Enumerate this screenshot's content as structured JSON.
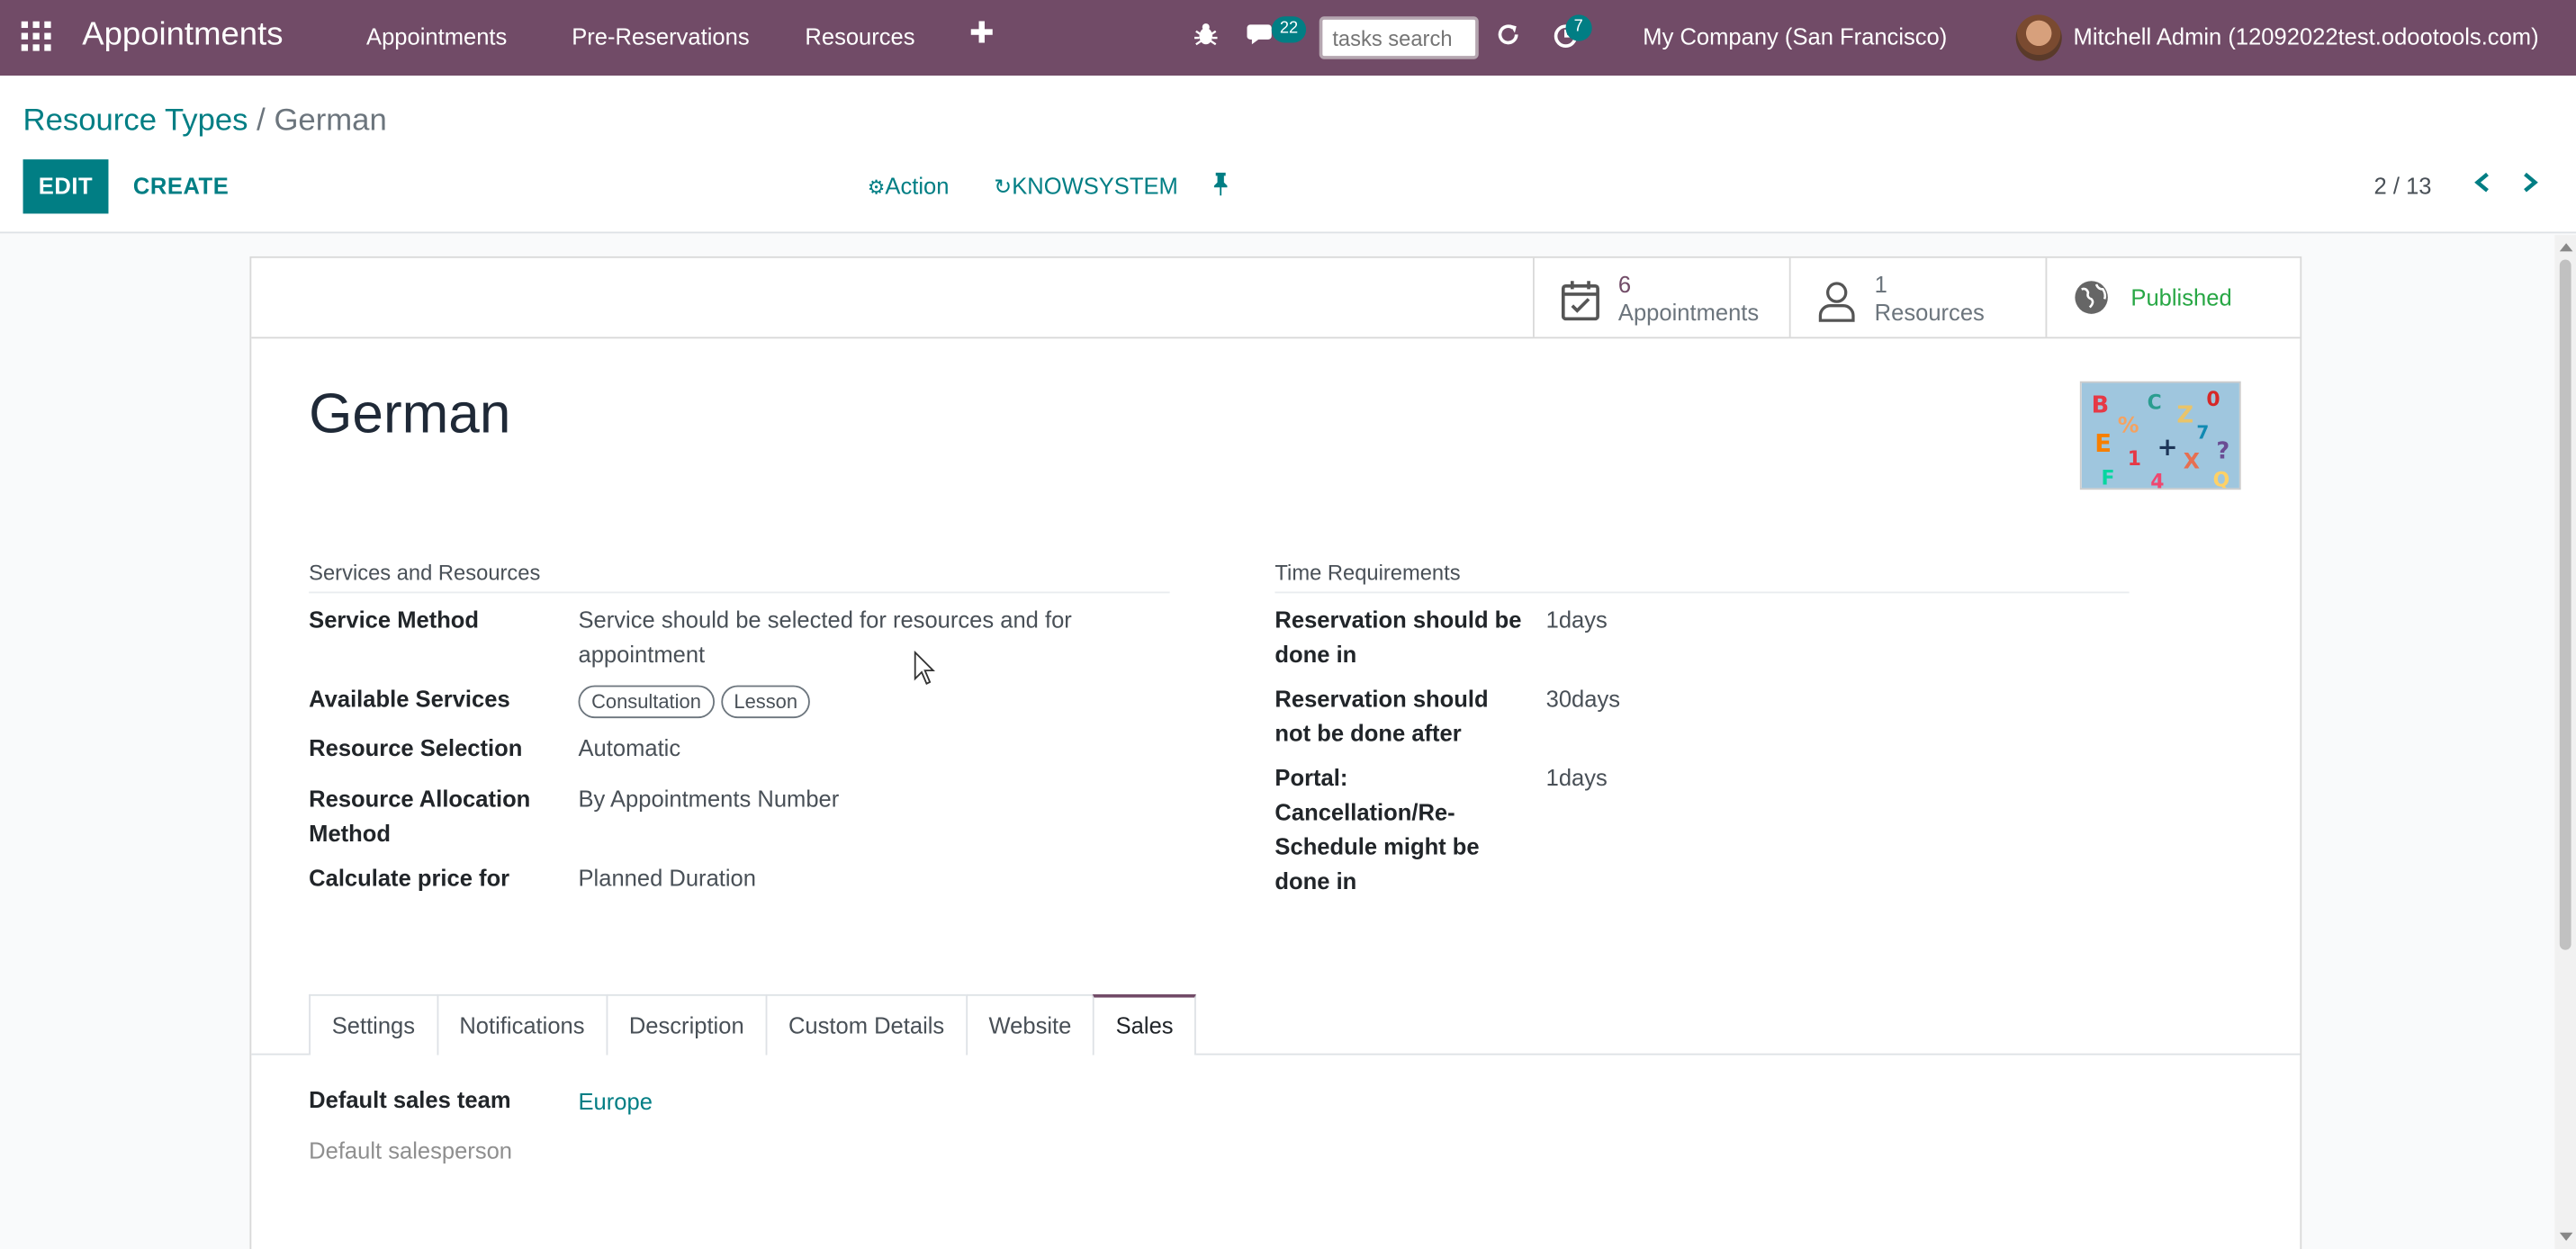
{
  "navbar": {
    "brand": "Appointments",
    "menu": [
      "Appointments",
      "Pre-Reservations",
      "Resources"
    ],
    "plus": "✚",
    "messages_count": "22",
    "search_placeholder": "tasks search",
    "activities_count": "7",
    "company": "My Company (San Francisco)",
    "user": "Mitchell Admin (12092022test.odootools.com)",
    "bg_color": "#714b67"
  },
  "breadcrumb": {
    "parent": "Resource Types",
    "separator": " / ",
    "current": "German"
  },
  "toolbar": {
    "edit": "EDIT",
    "create": "CREATE",
    "action": "Action",
    "knowsystem": "KNOWSYSTEM",
    "pager": "2 / 13"
  },
  "stat_buttons": {
    "appointments": {
      "value": "6",
      "label": "Appointments"
    },
    "resources": {
      "value": "1",
      "label": "Resources"
    },
    "published": "Published"
  },
  "record": {
    "title": "German"
  },
  "services_group": {
    "title": "Services and Resources",
    "service_method_label": "Service Method",
    "service_method_value": "Service should be selected for resources and for appointment",
    "available_services_label": "Available Services",
    "available_services": [
      "Consultation",
      "Lesson"
    ],
    "resource_selection_label": "Resource Selection",
    "resource_selection_value": "Automatic",
    "allocation_label": "Resource Allocation Method",
    "allocation_value": "By Appointments Number",
    "calculate_price_label": "Calculate price for",
    "calculate_price_value": "Planned Duration"
  },
  "time_group": {
    "title": "Time Requirements",
    "reservation_in_label": "Reservation should be done in",
    "reservation_in_value": "1days",
    "reservation_not_after_label": "Reservation should not be done after",
    "reservation_not_after_value": "30days",
    "portal_label": "Portal: Cancellation/Re-Schedule might be done in",
    "portal_value": "1days"
  },
  "tabs": [
    "Settings",
    "Notifications",
    "Description",
    "Custom Details",
    "Website",
    "Sales"
  ],
  "active_tab": "Sales",
  "sales_tab": {
    "sales_team_label": "Default sales team",
    "sales_team_value": "Europe",
    "salesperson_label": "Default salesperson"
  },
  "colors": {
    "primary": "#017e84",
    "brand": "#714b67",
    "published": "#28a745"
  }
}
